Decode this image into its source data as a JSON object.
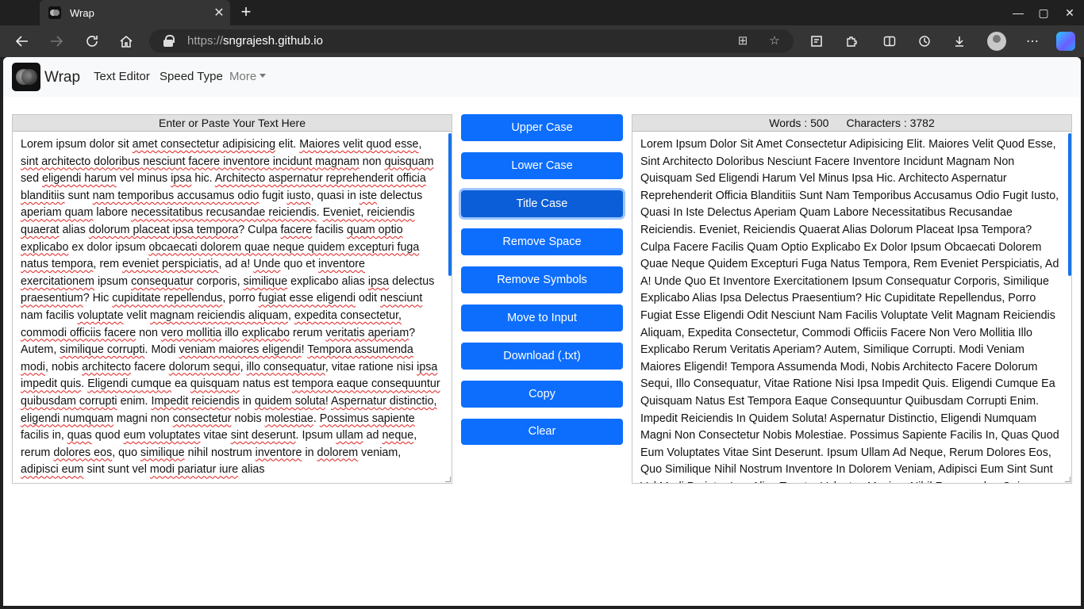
{
  "browser": {
    "tab_title": "Wrap",
    "new_tab": "+",
    "url_protocol": "https://",
    "url_host": "sngrajesh.github.io",
    "window_controls": [
      "—",
      "▢",
      "✕"
    ]
  },
  "nav": {
    "brand": "Wrap",
    "links": [
      "Text Editor",
      "Speed Type",
      "More"
    ]
  },
  "input_panel": {
    "header": "Enter or Paste Your Text Here",
    "segments": [
      {
        "t": "Lorem ipsum dolor sit "
      },
      {
        "t": "amet consectetur adipisicing",
        "s": 1
      },
      {
        "t": " elit. "
      },
      {
        "t": "Maiores velit quod esse",
        "s": 1
      },
      {
        "t": ", "
      },
      {
        "t": "sint architecto doloribus nesciunt facere inventore incidunt magnam",
        "s": 1
      },
      {
        "t": " non "
      },
      {
        "t": "quisquam",
        "s": 1
      },
      {
        "t": " sed "
      },
      {
        "t": "eligendi harum",
        "s": 1
      },
      {
        "t": " vel minus "
      },
      {
        "t": "ipsa",
        "s": 1
      },
      {
        "t": " hic. "
      },
      {
        "t": "Architecto aspernatur reprehenderit officia blanditiis",
        "s": 1
      },
      {
        "t": " sunt "
      },
      {
        "t": "nam temporibus accusamus odio",
        "s": 1
      },
      {
        "t": " fugit "
      },
      {
        "t": "iusto",
        "s": 1
      },
      {
        "t": ", quasi in "
      },
      {
        "t": "iste",
        "s": 1
      },
      {
        "t": " delectus "
      },
      {
        "t": "aperiam quam",
        "s": 1
      },
      {
        "t": " labore "
      },
      {
        "t": "necessitatibus recusandae reiciendis",
        "s": 1
      },
      {
        "t": ". "
      },
      {
        "t": "Eveniet, reiciendis quaerat",
        "s": 1
      },
      {
        "t": " alias "
      },
      {
        "t": "dolorum placeat ipsa tempora",
        "s": 1
      },
      {
        "t": "? Culpa "
      },
      {
        "t": "facere",
        "s": 1
      },
      {
        "t": " facilis "
      },
      {
        "t": "quam optio explicabo",
        "s": 1
      },
      {
        "t": " ex dolor ipsum "
      },
      {
        "t": "obcaecati dolorem quae neque quidem excepturi fuga natus tempora",
        "s": 1
      },
      {
        "t": ", rem "
      },
      {
        "t": "eveniet perspiciatis",
        "s": 1
      },
      {
        "t": ", ad a! "
      },
      {
        "t": "Unde",
        "s": 1
      },
      {
        "t": " quo et "
      },
      {
        "t": "inventore exercitationem",
        "s": 1
      },
      {
        "t": " ipsum "
      },
      {
        "t": "consequatur",
        "s": 1
      },
      {
        "t": " corporis, "
      },
      {
        "t": "similique",
        "s": 1
      },
      {
        "t": " explicabo alias "
      },
      {
        "t": "ipsa",
        "s": 1
      },
      {
        "t": " delectus "
      },
      {
        "t": "praesentium",
        "s": 1
      },
      {
        "t": "? Hic "
      },
      {
        "t": "cupiditate repellendus",
        "s": 1
      },
      {
        "t": ", porro "
      },
      {
        "t": "fugiat esse eligendi",
        "s": 1
      },
      {
        "t": " odit "
      },
      {
        "t": "nesciunt",
        "s": 1
      },
      {
        "t": " nam facilis "
      },
      {
        "t": "voluptate",
        "s": 1
      },
      {
        "t": " velit "
      },
      {
        "t": "magnam reiciendis aliquam",
        "s": 1
      },
      {
        "t": ", "
      },
      {
        "t": "expedita consectetur, commodi officiis facere",
        "s": 1
      },
      {
        "t": " non "
      },
      {
        "t": "vero mollitia",
        "s": 1
      },
      {
        "t": " illo "
      },
      {
        "t": "explicabo",
        "s": 1
      },
      {
        "t": " rerum "
      },
      {
        "t": "veritatis aperiam",
        "s": 1
      },
      {
        "t": "? Autem, "
      },
      {
        "t": "similique corrupti",
        "s": 1
      },
      {
        "t": ". Modi "
      },
      {
        "t": "veniam maiores eligendi",
        "s": 1
      },
      {
        "t": "! "
      },
      {
        "t": "Tempora assumenda modi",
        "s": 1
      },
      {
        "t": ", nobis "
      },
      {
        "t": "architecto",
        "s": 1
      },
      {
        "t": " facere "
      },
      {
        "t": "dolorum sequi",
        "s": 1
      },
      {
        "t": ", "
      },
      {
        "t": "illo consequatur",
        "s": 1
      },
      {
        "t": ", vitae ratione nisi "
      },
      {
        "t": "ipsa impedit quis",
        "s": 1
      },
      {
        "t": ". "
      },
      {
        "t": "Eligendi cumque",
        "s": 1
      },
      {
        "t": " ea "
      },
      {
        "t": "quisquam",
        "s": 1
      },
      {
        "t": " natus est "
      },
      {
        "t": "tempora eaque consequuntur quibusdam corrupti",
        "s": 1
      },
      {
        "t": " enim. "
      },
      {
        "t": "Impedit reiciendis",
        "s": 1
      },
      {
        "t": " in "
      },
      {
        "t": "quidem soluta",
        "s": 1
      },
      {
        "t": "! "
      },
      {
        "t": "Aspernatur distinctio, eligendi numquam",
        "s": 1
      },
      {
        "t": " magni non "
      },
      {
        "t": "consectetur",
        "s": 1
      },
      {
        "t": " nobis "
      },
      {
        "t": "molestiae",
        "s": 1
      },
      {
        "t": ". "
      },
      {
        "t": "Possimus sapiente",
        "s": 1
      },
      {
        "t": " facilis in, "
      },
      {
        "t": "quas",
        "s": 1
      },
      {
        "t": " quod "
      },
      {
        "t": "eum voluptates",
        "s": 1
      },
      {
        "t": " vitae "
      },
      {
        "t": "sint deserunt",
        "s": 1
      },
      {
        "t": ". Ipsum "
      },
      {
        "t": "ullam",
        "s": 1
      },
      {
        "t": " ad "
      },
      {
        "t": "neque",
        "s": 1
      },
      {
        "t": ", rerum "
      },
      {
        "t": "dolores eos",
        "s": 1
      },
      {
        "t": ", quo "
      },
      {
        "t": "similique",
        "s": 1
      },
      {
        "t": " nihil nostrum "
      },
      {
        "t": "inventore",
        "s": 1
      },
      {
        "t": " in "
      },
      {
        "t": "dolorem",
        "s": 1
      },
      {
        "t": " veniam, "
      },
      {
        "t": "adipisci eum",
        "s": 1
      },
      {
        "t": " sint sunt vel "
      },
      {
        "t": "modi pariatur iure",
        "s": 1
      },
      {
        "t": " alias"
      }
    ]
  },
  "buttons": {
    "upper_case": "Upper Case",
    "lower_case": "Lower Case",
    "title_case": "Title Case",
    "remove_space": "Remove Space",
    "remove_symbols": "Remove Symbols",
    "move_to_input": "Move to Input",
    "download": "Download (.txt)",
    "copy": "Copy",
    "clear": "Clear"
  },
  "output_panel": {
    "words_label": "Words : 500",
    "chars_label": "Characters : 3782",
    "text": "Lorem Ipsum Dolor Sit Amet Consectetur Adipisicing Elit. Maiores Velit Quod Esse, Sint Architecto Doloribus Nesciunt Facere Inventore Incidunt Magnam Non Quisquam Sed Eligendi Harum Vel Minus Ipsa Hic. Architecto Aspernatur Reprehenderit Officia Blanditiis Sunt Nam Temporibus Accusamus Odio Fugit Iusto, Quasi In Iste Delectus Aperiam Quam Labore Necessitatibus Recusandae Reiciendis. Eveniet, Reiciendis Quaerat Alias Dolorum Placeat Ipsa Tempora? Culpa Facere Facilis Quam Optio Explicabo Ex Dolor Ipsum Obcaecati Dolorem Quae Neque Quidem Excepturi Fuga Natus Tempora, Rem Eveniet Perspiciatis, Ad A! Unde Quo Et Inventore Exercitationem Ipsum Consequatur Corporis, Similique Explicabo Alias Ipsa Delectus Praesentium? Hic Cupiditate Repellendus, Porro Fugiat Esse Eligendi Odit Nesciunt Nam Facilis Voluptate Velit Magnam Reiciendis Aliquam, Expedita Consectetur, Commodi Officiis Facere Non Vero Mollitia Illo Explicabo Rerum Veritatis Aperiam? Autem, Similique Corrupti. Modi Veniam Maiores Eligendi! Tempora Assumenda Modi, Nobis Architecto Facere Dolorum Sequi, Illo Consequatur, Vitae Ratione Nisi Ipsa Impedit Quis. Eligendi Cumque Ea Quisquam Natus Est Tempora Eaque Consequuntur Quibusdam Corrupti Enim. Impedit Reiciendis In Quidem Soluta! Aspernatur Distinctio, Eligendi Numquam Magni Non Consectetur Nobis Molestiae. Possimus Sapiente Facilis In, Quas Quod Eum Voluptates Vitae Sint Deserunt. Ipsum Ullam Ad Neque, Rerum Dolores Eos, Quo Similique Nihil Nostrum Inventore In Dolorem Veniam, Adipisci Eum Sint Sunt Vel Modi Pariatur Iure Alias Tenetur Voluptas Maxime Nihil Recusandae Quia Consequuntur Accusantium Quod Officia Eveniet."
  },
  "colors": {
    "primary": "#0d6efd",
    "primary_active": "#0b5ed7",
    "spellcheck": "#e02020"
  }
}
